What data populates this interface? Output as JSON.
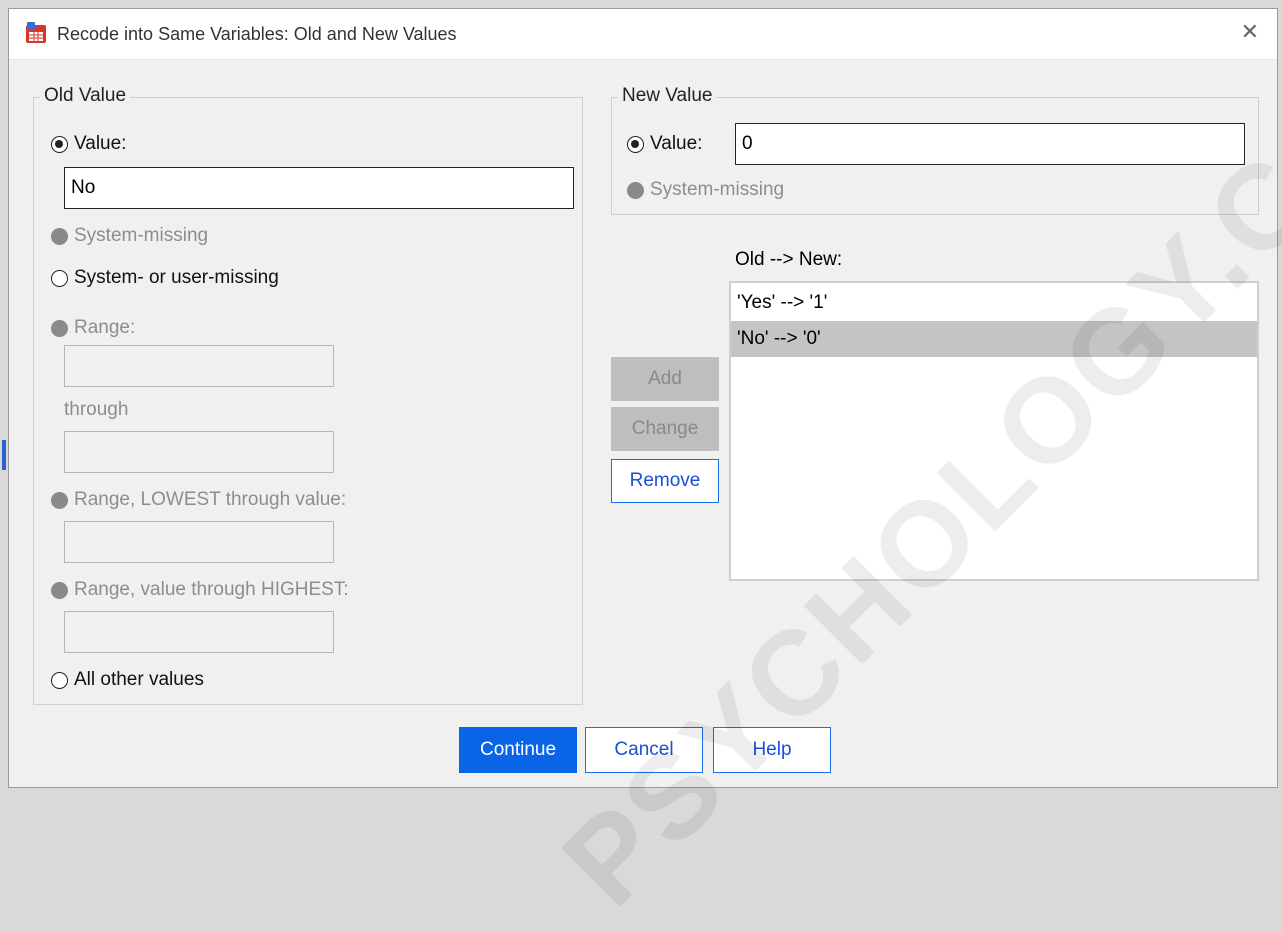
{
  "window": {
    "title": "Recode into Same Variables: Old and New Values",
    "close_glyph": "✕"
  },
  "old_value": {
    "legend": "Old Value",
    "value_radio": "Value:",
    "value_input": "No",
    "system_missing": "System-missing",
    "system_or_user_missing": "System- or user-missing",
    "range": "Range:",
    "through": "through",
    "range_lowest": "Range, LOWEST through value:",
    "range_highest": "Range, value through HIGHEST:",
    "all_other": "All other values"
  },
  "new_value": {
    "legend": "New Value",
    "value_radio": "Value:",
    "value_input": "0",
    "system_missing": "System-missing"
  },
  "mapping": {
    "label": "Old --> New:",
    "items": [
      "'Yes' --> '1'",
      "'No' --> '0'"
    ],
    "selected_index": 1
  },
  "buttons": {
    "add": "Add",
    "change": "Change",
    "remove": "Remove",
    "continue": "Continue",
    "cancel": "Cancel",
    "help": "Help"
  },
  "watermark": "PSYCHOLOGY.COM"
}
